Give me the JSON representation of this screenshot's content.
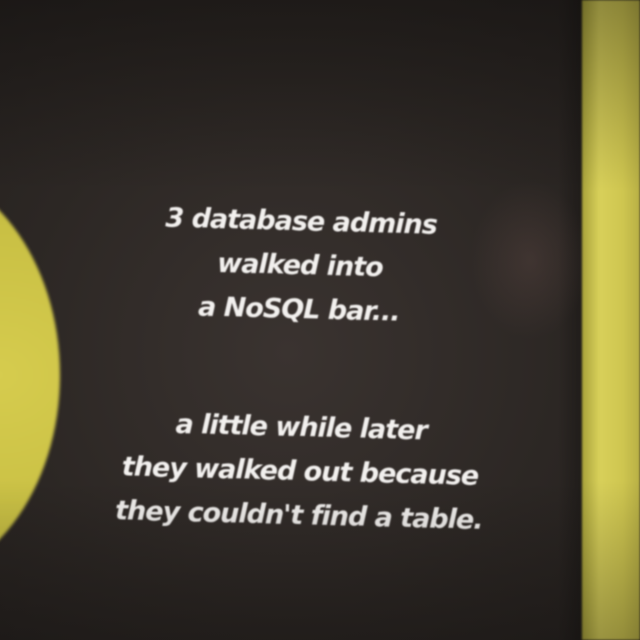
{
  "joke": {
    "setup": [
      "3 database admins",
      "walked into",
      "a NoSQL bar..."
    ],
    "punchline": [
      "a little while later",
      "they walked out because",
      "they couldn't find a table."
    ]
  },
  "colors": {
    "background": "#2a2522",
    "accent_yellow": "#d6cc4e",
    "text": "#f2f0ee"
  }
}
